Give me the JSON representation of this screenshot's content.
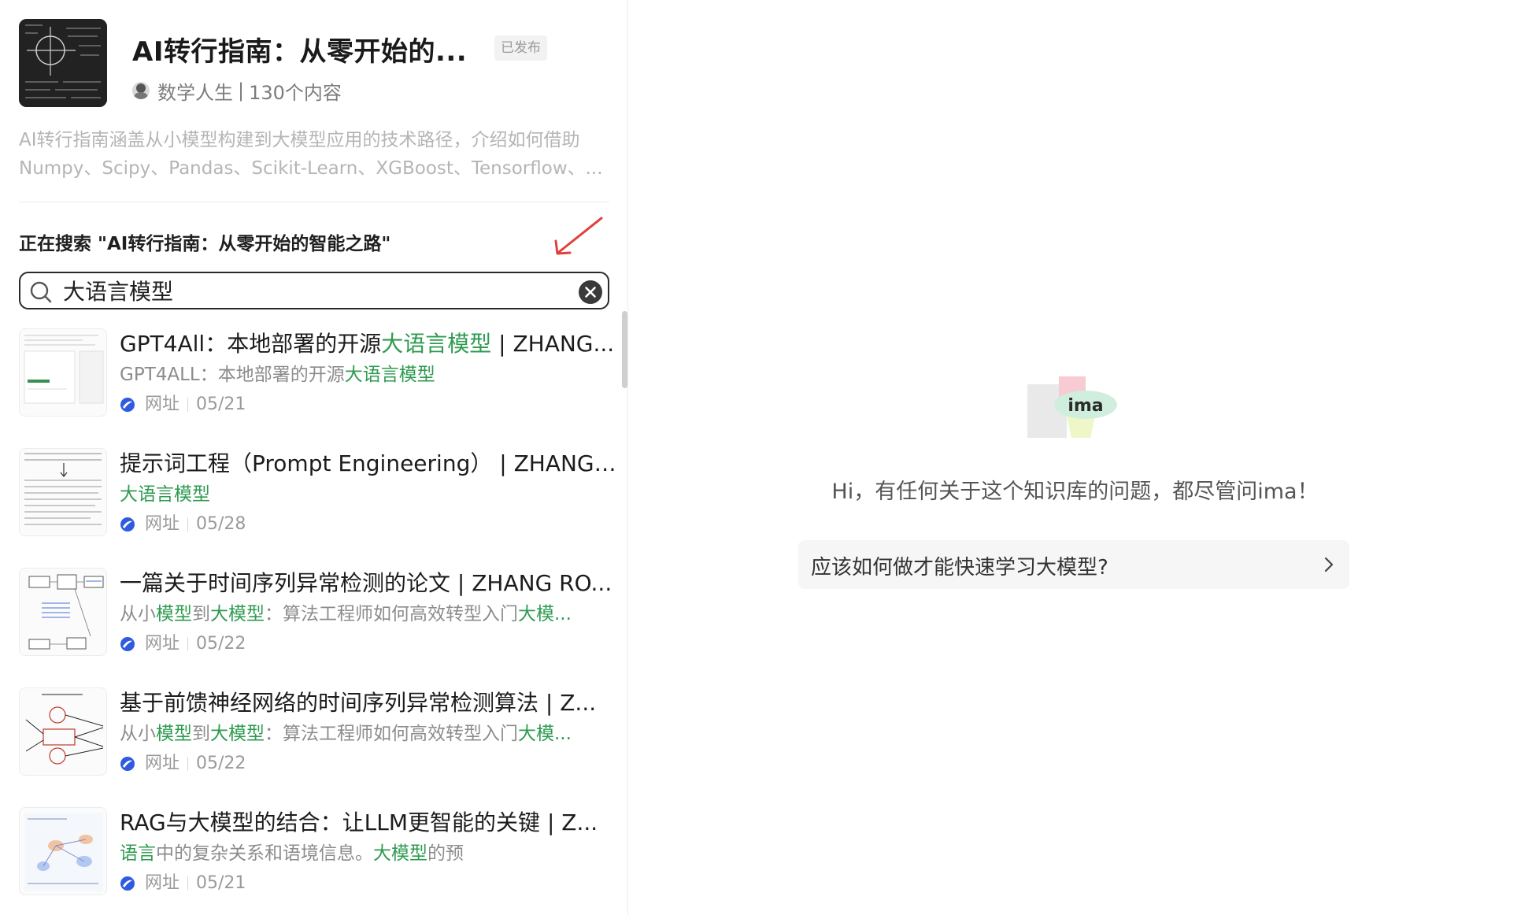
{
  "knowledge_base": {
    "title": "AI转行指南：从零开始的...",
    "status": "已发布",
    "author": "数学人生",
    "content_count": "130个内容",
    "description_line1": "AI转行指南涵盖从小模型构建到大模型应用的技术路径，介绍如何借助",
    "description_line2": "Numpy、Scipy、Pandas、Scikit-Learn、XGBoost、Tensorflow、..."
  },
  "search": {
    "scope_label": "正在搜索 \"AI转行指南：从零开始的智能之路\"",
    "value": "大语言模型"
  },
  "results": [
    {
      "title_pre": "GPT4All：本地部署的开源",
      "title_hl": "大语言模型",
      "title_post": " | ZHANG...",
      "snippet": [
        {
          "t": "GPT4ALL：本地部署的开源",
          "h": false
        },
        {
          "t": "大语言模型",
          "h": true
        }
      ],
      "type": "网址",
      "date": "05/21"
    },
    {
      "title_pre": "提示词工程（Prompt Engineering） | ZHANG ...",
      "title_hl": "",
      "title_post": "",
      "snippet": [
        {
          "t": "大语言模型",
          "h": true
        }
      ],
      "type": "网址",
      "date": "05/28"
    },
    {
      "title_pre": "一篇关于时间序列异常检测的论文 | ZHANG RO...",
      "title_hl": "",
      "title_post": "",
      "snippet": [
        {
          "t": "从小",
          "h": false
        },
        {
          "t": "模型",
          "h": true
        },
        {
          "t": "到",
          "h": false
        },
        {
          "t": "大模型",
          "h": true
        },
        {
          "t": "：算法工程师如何高效转型入门",
          "h": false
        },
        {
          "t": "大模...",
          "h": true
        }
      ],
      "type": "网址",
      "date": "05/22"
    },
    {
      "title_pre": "基于前馈神经网络的时间序列异常检测算法 | Z...",
      "title_hl": "",
      "title_post": "",
      "snippet": [
        {
          "t": "从小",
          "h": false
        },
        {
          "t": "模型",
          "h": true
        },
        {
          "t": "到",
          "h": false
        },
        {
          "t": "大模型",
          "h": true
        },
        {
          "t": "：算法工程师如何高效转型入门",
          "h": false
        },
        {
          "t": "大模...",
          "h": true
        }
      ],
      "type": "网址",
      "date": "05/22"
    },
    {
      "title_pre": "RAG与大模型的结合：让LLM更智能的关键 | Z...",
      "title_hl": "",
      "title_post": "",
      "snippet": [
        {
          "t": "语言",
          "h": true
        },
        {
          "t": "中的复杂关系和语境信息。",
          "h": false
        },
        {
          "t": "大模型",
          "h": true
        },
        {
          "t": "的预",
          "h": false
        }
      ],
      "type": "网址",
      "date": "05/21"
    }
  ],
  "assistant": {
    "logo_text": "ima",
    "greeting": "Hi，有任何关于这个知识库的问题，都尽管问ima！",
    "suggestion": "应该如何做才能快速学习大模型?"
  },
  "colors": {
    "highlight": "#2e9b50",
    "link_icon": "#2f5be0",
    "annotation_arrow": "#e0403a"
  }
}
